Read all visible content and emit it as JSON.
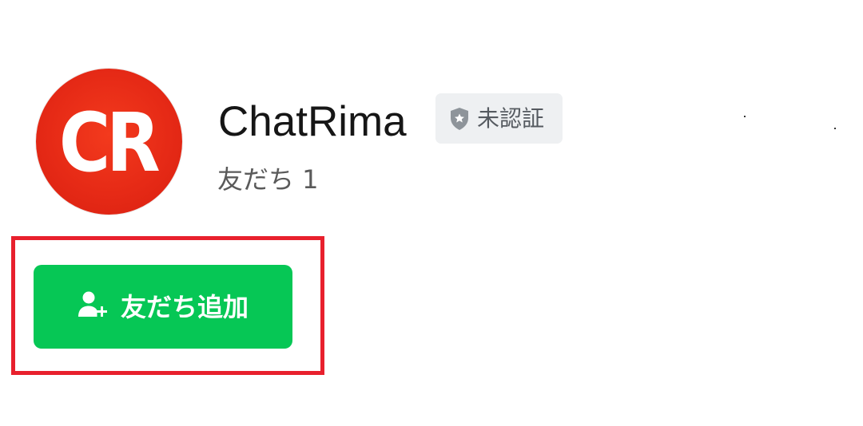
{
  "profile": {
    "avatar_initials": "CR",
    "name": "ChatRima",
    "verification_badge": "未認証",
    "friends_label": "友だち 1"
  },
  "actions": {
    "add_friend_label": "友だち追加"
  },
  "colors": {
    "avatar_red": "#e62a16",
    "button_green": "#06c755",
    "highlight_red": "#e8202d",
    "badge_bg": "#eef0f2"
  },
  "icons": {
    "badge": "shield-star-icon",
    "add_friend": "person-add-icon"
  }
}
